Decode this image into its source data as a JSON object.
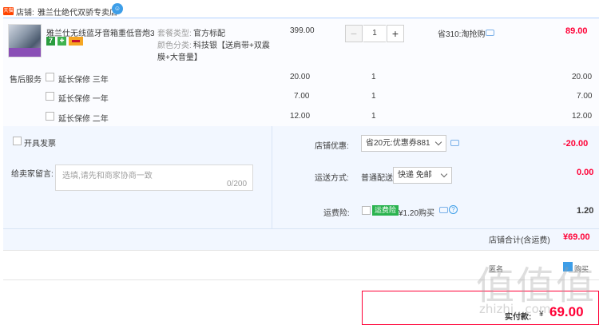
{
  "shop": {
    "badge": "天猫",
    "label": "店铺:",
    "name": "雅兰仕绝代双骄专卖店"
  },
  "item": {
    "title": "雅兰仕无线蓝牙音箱重低音炮3...",
    "spec_type_label": "套餐类型:",
    "spec_type_value": "官方标配",
    "spec_color_label": "颜色分类:",
    "spec_color_value_line1": "科技银【送肩带+双震",
    "spec_color_value_line2": "膜+大音量】",
    "tag_seven": "7",
    "unit_price": "399.00",
    "quantity": "1",
    "minus": "−",
    "plus": "+",
    "promo": "省310:淘抢购",
    "total": "89.00"
  },
  "service": {
    "title": "售后服务",
    "rows": [
      {
        "label": "延长保修 三年",
        "price": "20.00",
        "qty": "1",
        "total": "20.00"
      },
      {
        "label": "延长保修 一年",
        "price": "7.00",
        "qty": "1",
        "total": "7.00"
      },
      {
        "label": "延长保修 二年",
        "price": "12.00",
        "qty": "1",
        "total": "12.00"
      }
    ]
  },
  "options": {
    "invoice_label": "开具发票",
    "message_label": "给卖家留言:",
    "message_placeholder": "选填,请先和商家协商一致",
    "message_count": "0/200",
    "coupon_label": "店铺优惠:",
    "coupon_value": "省20元:优惠券881",
    "coupon_amount": "-20.00",
    "shipping_label": "运送方式:",
    "shipping_method": "普通配送",
    "shipping_value": "快递 免邮",
    "shipping_amount": "0.00",
    "insurance_label": "运费险:",
    "insurance_badge": "运费险",
    "insurance_text": "¥1.20购买",
    "help": "?",
    "insurance_amount": "1.20",
    "shop_total_label": "店铺合计(含运费)",
    "shop_total": "¥69.00"
  },
  "footer": {
    "anonymous_label": "匿名",
    "anonymous_side": "购买",
    "pay_label": "实付款:",
    "pay_symbol": "¥",
    "pay_total": "69.00"
  },
  "watermark": {
    "glyphs": "值值值",
    "domain": "zhizhi...com"
  },
  "colors": {
    "accent_red": "#ff0036",
    "link_blue": "#3d9ee8",
    "panel_blue": "#f2f7ff",
    "insurance_green": "#2bb34f"
  }
}
